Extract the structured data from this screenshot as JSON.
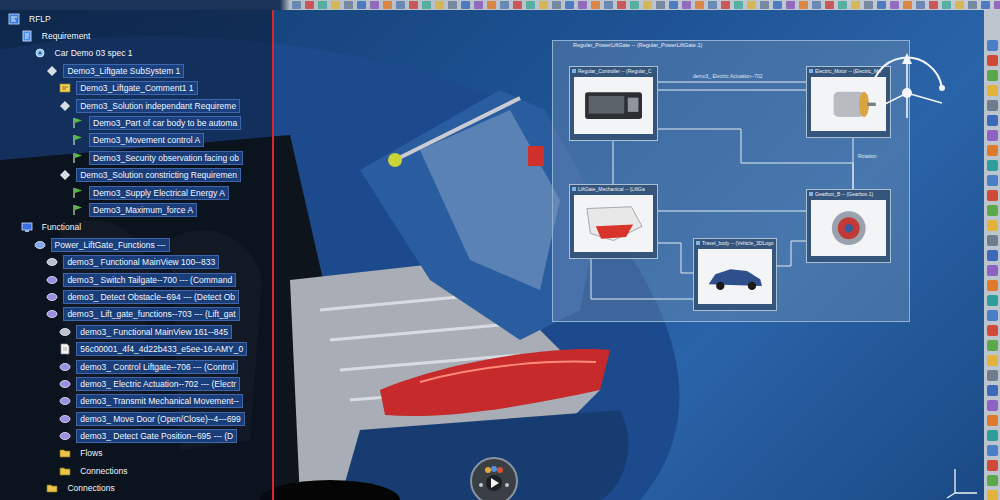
{
  "tree": [
    {
      "label": "RFLP",
      "kind": "root",
      "depth": 0,
      "selected": false
    },
    {
      "label": "Requirement",
      "kind": "req-folder",
      "depth": 1,
      "selected": false
    },
    {
      "label": "Car Demo 03 spec 1",
      "kind": "spec",
      "depth": 2,
      "selected": false
    },
    {
      "label": "Demo3_Liftgate SubSystem 1",
      "kind": "requirement",
      "depth": 3,
      "selected": true
    },
    {
      "label": "Demo3_Liftgate_Comment1 1",
      "kind": "comment",
      "depth": 4,
      "selected": true
    },
    {
      "label": "Demo3_Solution independant Requireme",
      "kind": "requirement",
      "depth": 4,
      "selected": true
    },
    {
      "label": "Demo3_Part of car body to be automa",
      "kind": "leaf",
      "depth": 5,
      "selected": true
    },
    {
      "label": "Demo3_Movement control A",
      "kind": "leaf",
      "depth": 5,
      "selected": true
    },
    {
      "label": "Demo3_Security observation facing ob",
      "kind": "leaf",
      "depth": 5,
      "selected": true
    },
    {
      "label": "Demo3_Solution constricting Requiremen",
      "kind": "requirement",
      "depth": 4,
      "selected": true
    },
    {
      "label": "Demo3_Supply Electrical Energy A",
      "kind": "leaf",
      "depth": 5,
      "selected": true
    },
    {
      "label": "Demo3_Maximum_force A",
      "kind": "leaf",
      "depth": 5,
      "selected": true
    },
    {
      "label": "Functional",
      "kind": "func-folder",
      "depth": 1,
      "selected": false
    },
    {
      "label": "Power_LiftGate_Functions ---",
      "kind": "function-group",
      "depth": 2,
      "selected": true
    },
    {
      "label": "demo3_ Functional MainView 100--833",
      "kind": "view",
      "depth": 3,
      "selected": true
    },
    {
      "label": "demo3_ Switch Tailgate--700 --- (Command",
      "kind": "function",
      "depth": 3,
      "selected": true
    },
    {
      "label": "demo3_ Detect Obstacle--694 --- (Detect Ob",
      "kind": "function",
      "depth": 3,
      "selected": true
    },
    {
      "label": "demo3_ Lift_gate_functions--703 --- (Lift_gat",
      "kind": "function",
      "depth": 3,
      "selected": true
    },
    {
      "label": "demo3_ Functional MainView 161--845",
      "kind": "view",
      "depth": 4,
      "selected": true
    },
    {
      "label": "56c00001_4f4_4d22b433_e5ee-16-AMY_0",
      "kind": "doc",
      "depth": 4,
      "selected": true
    },
    {
      "label": "demo3_ Control Liftgate--706 --- (Control",
      "kind": "function",
      "depth": 4,
      "selected": true
    },
    {
      "label": "demo3_ Electric Actuation--702 --- (Electr",
      "kind": "function",
      "depth": 4,
      "selected": true
    },
    {
      "label": "demo3_ Transmit Mechanical Movement--",
      "kind": "function",
      "depth": 4,
      "selected": true
    },
    {
      "label": "demo3_ Move Door (Open/Close)--4---699",
      "kind": "function",
      "depth": 4,
      "selected": true
    },
    {
      "label": "demo3_ Detect Gate Position--695 --- (D",
      "kind": "function",
      "depth": 4,
      "selected": true
    },
    {
      "label": "Flows",
      "kind": "folder",
      "depth": 4,
      "selected": false
    },
    {
      "label": "Connections",
      "kind": "folder",
      "depth": 4,
      "selected": false
    },
    {
      "label": "Connections",
      "kind": "folder",
      "depth": 3,
      "selected": false
    }
  ],
  "diagram": {
    "title": "Regular_PowerLiftGate -- (Regular_PowerLiftGate.1)",
    "nodes": [
      {
        "title": "Regular_Controller -- (Regular_C",
        "kind": "controller"
      },
      {
        "title": "Electric_Motor -- (Electric_Mo",
        "kind": "motor"
      },
      {
        "title": "LiftGate_Mechanical -- (LiftGa",
        "kind": "panel"
      },
      {
        "title": "Travel_body -- (Vehicle_3DLogo",
        "kind": "car"
      },
      {
        "title": "Gearbox_B -- (Gearbox.1)",
        "kind": "gear"
      }
    ],
    "flow_labels": [
      "demo3_ Electric Actuation--702",
      "Rotation"
    ]
  }
}
